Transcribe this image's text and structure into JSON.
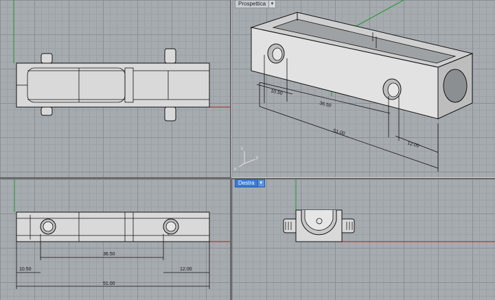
{
  "viewports": {
    "top": {
      "name": ""
    },
    "perspective": {
      "name": "Prospettica"
    },
    "front": {
      "name": ""
    },
    "right": {
      "name": "Destra"
    }
  },
  "dimensions": {
    "d1": "10.50",
    "d2": "36.50",
    "d3": "51.00",
    "d4": "12.00"
  },
  "icons": {
    "dropdown": "chevron-down-icon",
    "axis": "axis-triad-icon"
  },
  "colors": {
    "grid_bg": "#a6abaf",
    "x_axis": "#b01e1e",
    "y_axis": "#1d9a2a",
    "active_tab": "#3b7bd5"
  }
}
